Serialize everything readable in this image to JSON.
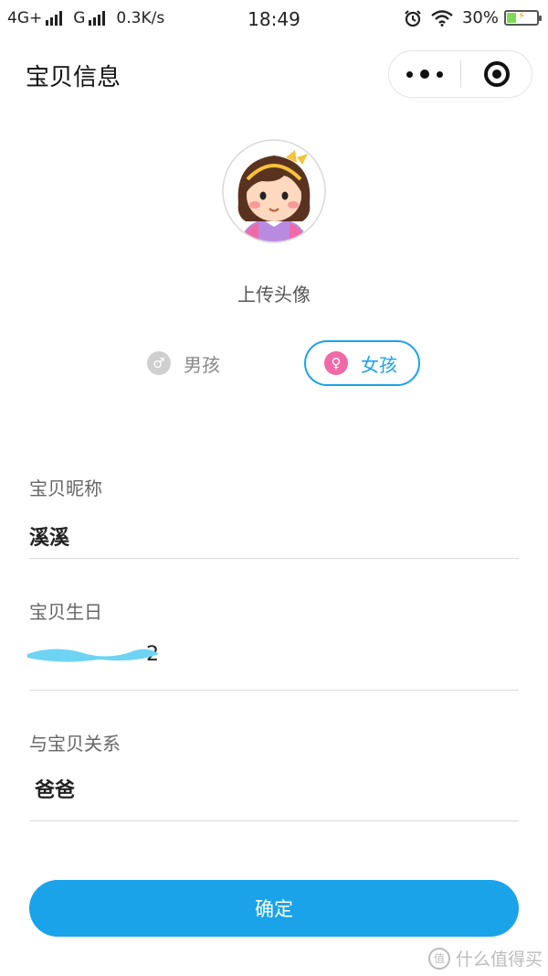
{
  "status_bar": {
    "network1": "4G+",
    "network2": "G",
    "speed": "0.3K/s",
    "time": "18:49",
    "battery": "30%",
    "battery_level": 0.3
  },
  "nav": {
    "title": "宝贝信息"
  },
  "avatar": {
    "upload_label": "上传头像"
  },
  "gender": {
    "boy_label": "男孩",
    "girl_label": "女孩",
    "selected": "girl"
  },
  "form": {
    "nickname_label": "宝贝昵称",
    "nickname_value": "溪溪",
    "birthday_label": "宝贝生日",
    "birthday_value_visible": "2",
    "relation_label": "与宝贝关系",
    "relation_value": "爸爸"
  },
  "confirm_label": "确定",
  "watermark": "什么值得买",
  "colors": {
    "accent": "#1aa3e8",
    "girl_pink": "#f06aa7",
    "boy_gray": "#cfcfcf"
  }
}
